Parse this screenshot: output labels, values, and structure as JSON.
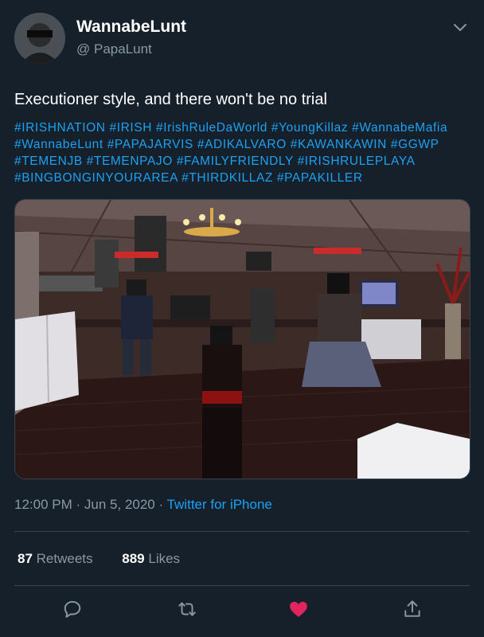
{
  "user": {
    "display_name": "WannabeLunt",
    "handle": "@ PapaLunt"
  },
  "tweet": {
    "text": "Executioner style, and there won't be no trial",
    "hashtags": [
      "#IRISHNATION",
      "#IRISH",
      "#IrishRuleDaWorld",
      "#YoungKillaz",
      "#WannabeMafia",
      "#WannabeLunt",
      "#PAPAJARVIS",
      "#ADIKALVARO",
      "#KAWANKAWIN",
      "#GGWP",
      "#TEMENJB",
      "#TEMENPAJO",
      "#FAMILYFRIENDLY",
      "#IRISHRULEPLAYA",
      "#BINGBONGINYOURAREA",
      "#THIRDKILLAZ",
      "#PAPAKILLER"
    ],
    "time": "12:00 PM",
    "date": "Jun 5, 2020",
    "source": "Twitter for iPhone"
  },
  "stats": {
    "retweets_count": "87",
    "retweets_label": "Retweets",
    "likes_count": "889",
    "likes_label": "Likes"
  },
  "icons": {
    "more": "chevron-down-icon",
    "reply": "reply-icon",
    "retweet": "retweet-icon",
    "like": "heart-icon",
    "share": "share-icon"
  },
  "colors": {
    "background": "#15202b",
    "link": "#1da1f2",
    "secondary_text": "#8899a6",
    "divider": "#38444d",
    "like": "#e0245e"
  }
}
